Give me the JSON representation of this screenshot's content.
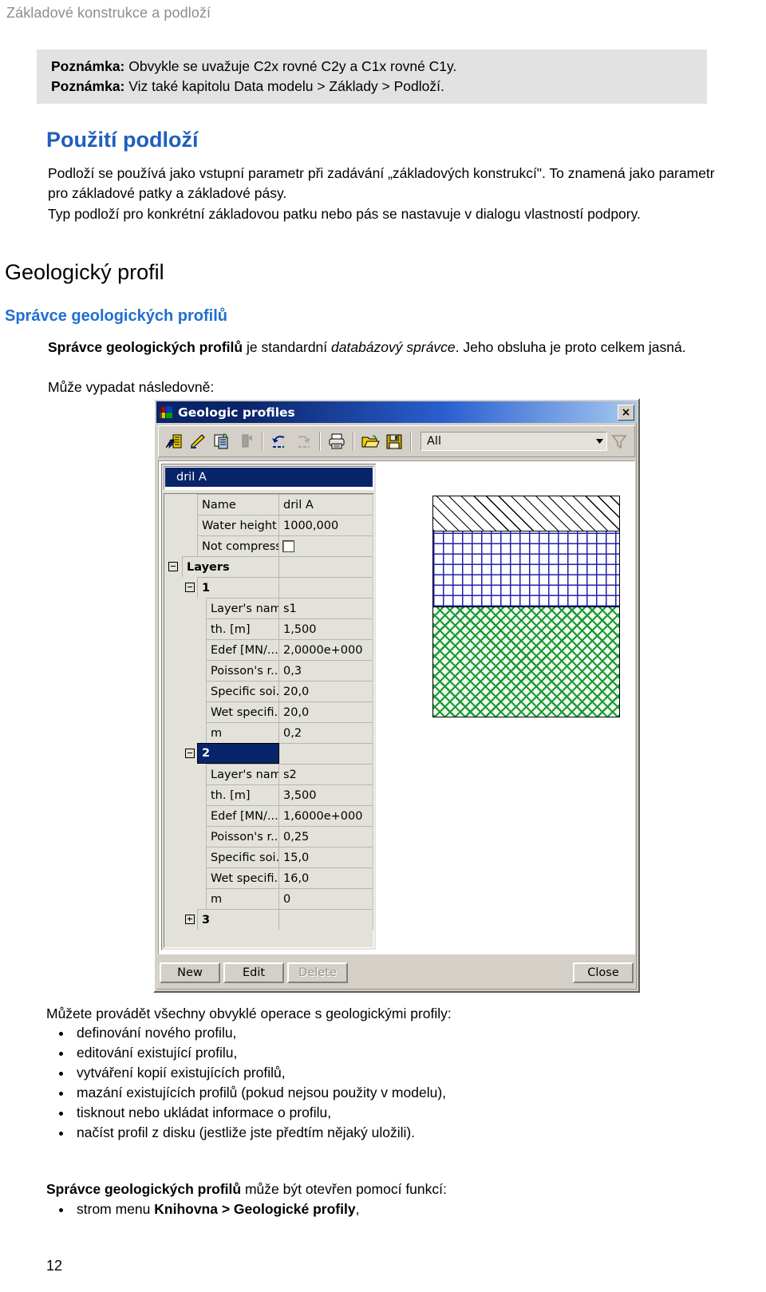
{
  "header": {
    "running_title": "Základové konstrukce a podloží"
  },
  "note_box": {
    "lines": [
      {
        "label": "Poznámka:",
        "text": " Obvykle se uvažuje C2x rovné C2y a C1x rovné C1y."
      },
      {
        "label": "Poznámka:",
        "text": " Viz také kapitolu Data modelu > Základy > Podloží."
      }
    ]
  },
  "sections": {
    "usage_heading": "Použití podloží",
    "usage_paragraph_1": "Podloží se používá jako vstupní parametr při zadávání „základových konstrukcí\". To znamená jako parametr pro základové patky a základové pásy.",
    "usage_paragraph_2": "Typ podloží pro konkrétní základovou patku nebo pás se nastavuje v dialogu vlastností podpory.",
    "geo_heading": "Geologický profil",
    "manager_heading": "Správce geologických profilů",
    "manager_para_bold": "Správce geologických profilů",
    "manager_para_rest_1": " je standardní ",
    "manager_para_italic": "databázový správce",
    "manager_para_rest_2": ". Jeho obsluha je proto celkem jasná.",
    "manager_para_line3": "Může vypadat následovně:"
  },
  "dialog": {
    "title": "Geologic profiles",
    "title_icon": "windows-logo-icon",
    "close_label": "×",
    "toolbar": {
      "buttons": [
        {
          "name": "new-record-icon",
          "label": "New record"
        },
        {
          "name": "edit-record-icon",
          "label": "Edit record"
        },
        {
          "name": "copy-record-icon",
          "label": "Copy record"
        },
        {
          "name": "delete-record-icon",
          "label": "Delete record"
        },
        {
          "name": "undo-icon",
          "label": "Undo"
        },
        {
          "name": "redo-icon",
          "label": "Redo"
        },
        {
          "name": "print-icon",
          "label": "Print"
        },
        {
          "name": "open-folder-icon",
          "label": "Open"
        },
        {
          "name": "save-icon",
          "label": "Save"
        }
      ],
      "filter_value": "All",
      "filter_icon": "funnel-filter-icon"
    },
    "profile_list": {
      "selected_item": "dril A"
    },
    "properties": [
      {
        "indent": 1,
        "name": "Name",
        "value": "dril A",
        "kind": "text"
      },
      {
        "indent": 1,
        "name": "Water height [...",
        "value": "1000,000",
        "kind": "text"
      },
      {
        "indent": 1,
        "name": "Not compressi...",
        "value": "",
        "kind": "checkbox"
      },
      {
        "indent": 0,
        "name": "Layers",
        "value": "",
        "kind": "group",
        "expander": "minus"
      },
      {
        "indent": 1,
        "name": "1",
        "value": "",
        "kind": "group",
        "expander": "minus"
      },
      {
        "indent": 2,
        "name": "Layer's name",
        "value": "s1",
        "kind": "text"
      },
      {
        "indent": 2,
        "name": "th.  [m]",
        "value": "1,500",
        "kind": "text"
      },
      {
        "indent": 2,
        "name": "Edef [MN/...",
        "value": "2,0000e+000",
        "kind": "text"
      },
      {
        "indent": 2,
        "name": "Poisson's r...",
        "value": "0,3",
        "kind": "text"
      },
      {
        "indent": 2,
        "name": "Specific soi...",
        "value": "20,0",
        "kind": "text"
      },
      {
        "indent": 2,
        "name": "Wet specifi...",
        "value": "20,0",
        "kind": "text"
      },
      {
        "indent": 2,
        "name": "m",
        "value": "0,2",
        "kind": "text"
      },
      {
        "indent": 1,
        "name": "2",
        "value": "",
        "kind": "group-selected",
        "expander": "minus"
      },
      {
        "indent": 2,
        "name": "Layer's name",
        "value": "s2",
        "kind": "text"
      },
      {
        "indent": 2,
        "name": "th.  [m]",
        "value": "3,500",
        "kind": "text"
      },
      {
        "indent": 2,
        "name": "Edef [MN/...",
        "value": "1,6000e+000",
        "kind": "text"
      },
      {
        "indent": 2,
        "name": "Poisson's r...",
        "value": "0,25",
        "kind": "text"
      },
      {
        "indent": 2,
        "name": "Specific soi...",
        "value": "15,0",
        "kind": "text"
      },
      {
        "indent": 2,
        "name": "Wet specifi...",
        "value": "16,0",
        "kind": "text"
      },
      {
        "indent": 2,
        "name": "m",
        "value": "0",
        "kind": "text"
      },
      {
        "indent": 1,
        "name": "3",
        "value": "",
        "kind": "group",
        "expander": "plus"
      }
    ],
    "soil_layers": [
      {
        "name": "layer-1-hatch",
        "pattern": "diagonal-hatch",
        "color": "#000000"
      },
      {
        "name": "layer-2-grid",
        "pattern": "square-grid",
        "color": "#2020b0"
      },
      {
        "name": "layer-3-crosshatch",
        "pattern": "diagonal-crosshatch",
        "color": "#1a9a33"
      }
    ],
    "buttons": {
      "new": "New",
      "edit": "Edit",
      "delete": "Delete",
      "close": "Close"
    }
  },
  "bottom": {
    "intro": "Můžete provádět všechny obvyklé operace s geologickými profily:",
    "bullets": [
      "definování nového profilu,",
      "editování existující profilu,",
      "vytváření kopií existujících profilů,",
      "mazání existujících profilů (pokud nejsou použity v modelu),",
      "tisknout nebo ukládat informace o profilu,",
      "načíst profil z disku (jestliže jste předtím nějaký uložili)."
    ],
    "open_intro_bold": "Správce geologických profilů",
    "open_intro_rest": " může být otevřen pomocí funkcí:",
    "open_bullet_prefix": "strom menu ",
    "open_bullet_bold": "Knihovna > Geologické profily",
    "open_bullet_suffix": ","
  },
  "page_number": "12"
}
